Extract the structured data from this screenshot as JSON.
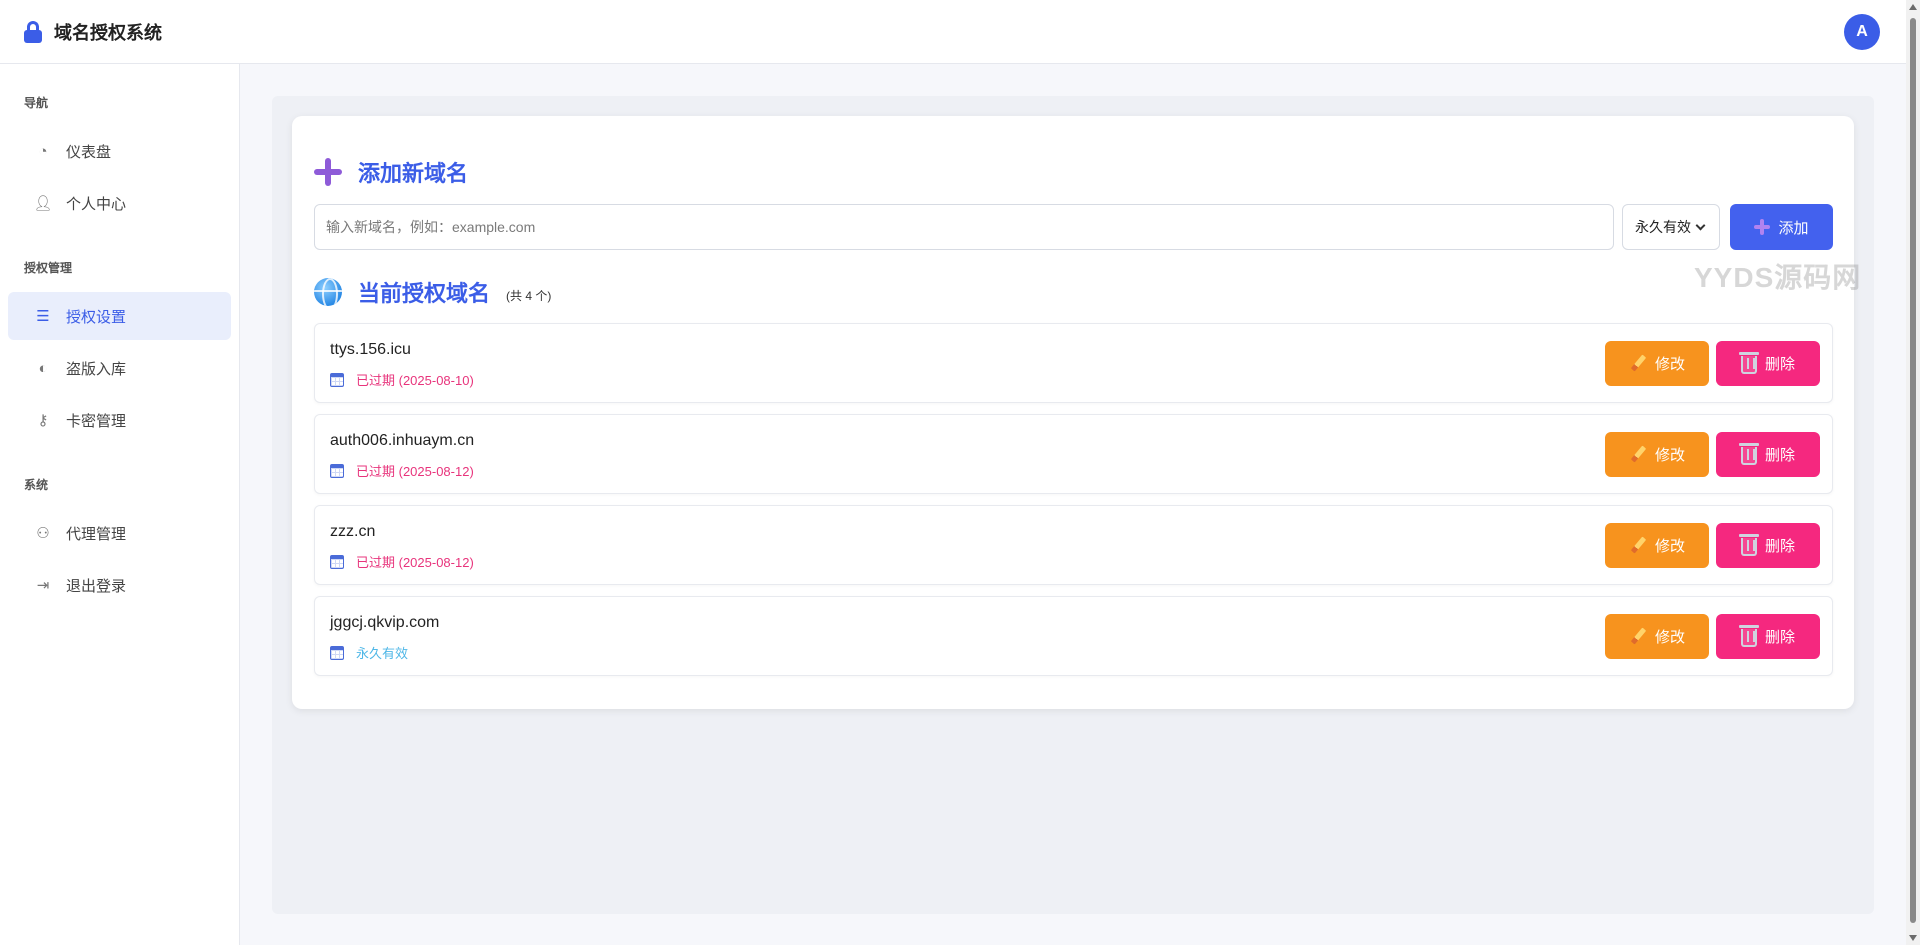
{
  "app": {
    "title": "域名授权系统",
    "avatar_letter": "A"
  },
  "sidebar": {
    "sections": [
      {
        "label": "导航"
      },
      {
        "label": "授权管理"
      },
      {
        "label": "系统"
      }
    ],
    "items": [
      {
        "label": "仪表盘",
        "icon": "pie-chart-icon"
      },
      {
        "label": "个人中心",
        "icon": "user-icon"
      },
      {
        "label": "授权设置",
        "icon": "sliders-icon",
        "active": true
      },
      {
        "label": "盗版入库",
        "icon": "shield-icon"
      },
      {
        "label": "卡密管理",
        "icon": "key-icon"
      },
      {
        "label": "代理管理",
        "icon": "users-icon"
      },
      {
        "label": "退出登录",
        "icon": "logout-icon"
      }
    ]
  },
  "add_section": {
    "title": "添加新域名",
    "input_placeholder": "输入新域名，例如：example.com",
    "input_value": "",
    "select_value": "永久有效",
    "add_label": "添加"
  },
  "list_section": {
    "title": "当前授权域名",
    "count_label": "(共 4 个)"
  },
  "watermark": "YYDS源码网",
  "domains": [
    {
      "name": "ttys.156.icu",
      "status": "已过期 (2025-08-10)",
      "status_type": "expired"
    },
    {
      "name": "auth006.inhuaym.cn",
      "status": "已过期 (2025-08-12)",
      "status_type": "expired"
    },
    {
      "name": "zzz.cn",
      "status": "已过期 (2025-08-12)",
      "status_type": "expired"
    },
    {
      "name": "jggcj.qkvip.com",
      "status": "永久有效",
      "status_type": "permanent"
    }
  ],
  "actions": {
    "edit_label": "修改",
    "delete_label": "删除"
  },
  "colors": {
    "accent": "#3b5de7",
    "edit": "#f7931e",
    "delete": "#f5287f",
    "expired": "#e8347c",
    "permanent": "#4fb7e7"
  }
}
